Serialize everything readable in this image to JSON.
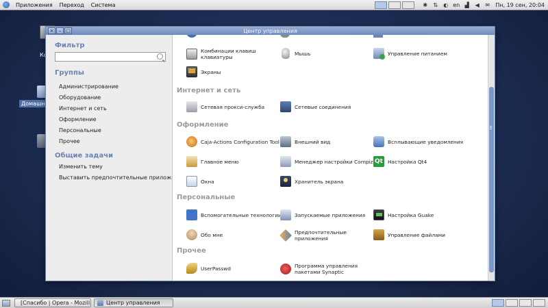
{
  "top_panel": {
    "menus": [
      "Приложения",
      "Переход",
      "Система"
    ],
    "lang": "en",
    "clock": "Пн, 19 сен, 20:04"
  },
  "desktop": {
    "computer_label": "Ко",
    "home_label": "Домашни"
  },
  "window": {
    "title": "Центр управления",
    "sidebar": {
      "filter_heading": "Фильтр",
      "filter_value": "",
      "groups_heading": "Группы",
      "groups": [
        "Администрирование",
        "Оборудование",
        "Интернет и сеть",
        "Оформление",
        "Персональные",
        "Прочее"
      ],
      "tasks_heading": "Общие задачи",
      "tasks": [
        "Изменить тему",
        "Выставить предпочтительные приложения"
      ]
    },
    "content": {
      "hardware": [
        {
          "label": "Комбинации клавиш клавиатуры",
          "icon": "keyboard-icon"
        },
        {
          "label": "Мышь",
          "icon": "mouse-icon"
        },
        {
          "label": "Управление питанием",
          "icon": "power-icon"
        },
        {
          "label": "Экраны",
          "icon": "display-icon"
        }
      ],
      "internet": {
        "title": "Интернет и сеть",
        "items": [
          {
            "label": "Сетевая прокси-служба",
            "icon": "proxy-icon"
          },
          {
            "label": "Сетевые соединения",
            "icon": "network-icon"
          }
        ]
      },
      "appearance": {
        "title": "Оформление",
        "items": [
          {
            "label": "Caja-Actions Configuration Tool",
            "icon": "caja-icon"
          },
          {
            "label": "Внешний вид",
            "icon": "appearance-icon"
          },
          {
            "label": "Всплывающие уведомления",
            "icon": "notification-icon"
          },
          {
            "label": "Главное меню",
            "icon": "main-menu-icon"
          },
          {
            "label": "Менеджер настройки Compiz",
            "icon": "compiz-icon"
          },
          {
            "label": "Настройка Qt4",
            "icon": "qt-icon"
          },
          {
            "label": "Окна",
            "icon": "windows-icon"
          },
          {
            "label": "Хранитель экрана",
            "icon": "screensaver-icon"
          }
        ]
      },
      "personal": {
        "title": "Персональные",
        "items": [
          {
            "label": "Вспомогательные технологии",
            "icon": "accessibility-icon"
          },
          {
            "label": "Запускаемые приложения",
            "icon": "startup-apps-icon"
          },
          {
            "label": "Настройка Guake",
            "icon": "guake-icon"
          },
          {
            "label": "Обо мне",
            "icon": "about-me-icon"
          },
          {
            "label": "Предпочтительные приложения",
            "icon": "preferred-apps-icon"
          },
          {
            "label": "Управление файлами",
            "icon": "file-management-icon"
          }
        ]
      },
      "other": {
        "title": "Прочее",
        "items": [
          {
            "label": "UserPasswd",
            "icon": "keys-icon"
          },
          {
            "label": "Программа управления пакетами Synaptic",
            "icon": "synaptic-icon"
          }
        ]
      }
    }
  },
  "taskbar": {
    "tasks": [
      {
        "label": "[Спасибо | Opera - Mozill...",
        "active": false
      },
      {
        "label": "Центр управления",
        "active": true
      }
    ]
  }
}
